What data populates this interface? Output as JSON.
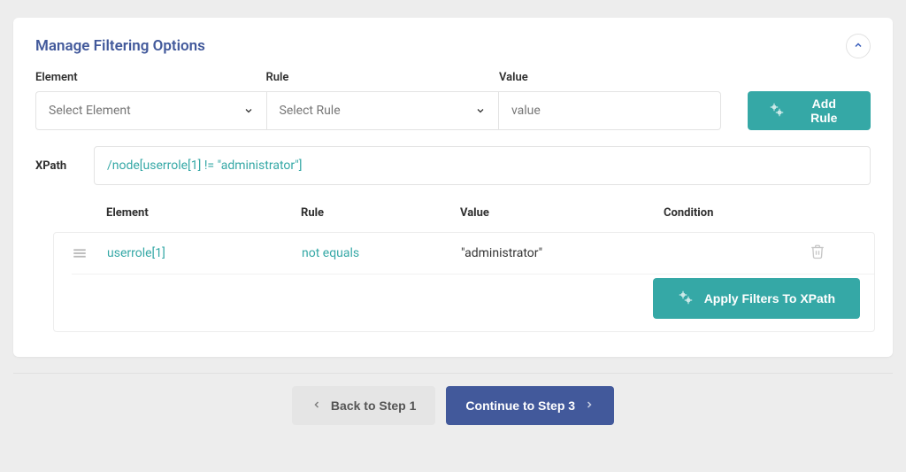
{
  "header": {
    "title": "Manage Filtering Options"
  },
  "filter": {
    "element_label": "Element",
    "element_placeholder": "Select Element",
    "rule_label": "Rule",
    "rule_placeholder": "Select Rule",
    "value_label": "Value",
    "value_placeholder": "value",
    "add_rule_label": "Add Rule"
  },
  "xpath": {
    "label": "XPath",
    "value": "/node[userrole[1] != \"administrator\"]"
  },
  "table": {
    "header_element": "Element",
    "header_rule": "Rule",
    "header_value": "Value",
    "header_condition": "Condition",
    "rows": [
      {
        "element": "userrole[1]",
        "rule": "not equals",
        "value": "\"administrator\"",
        "condition": ""
      }
    ],
    "apply_label": "Apply Filters To XPath"
  },
  "nav": {
    "back_label": "Back to Step 1",
    "next_label": "Continue to Step 3"
  }
}
